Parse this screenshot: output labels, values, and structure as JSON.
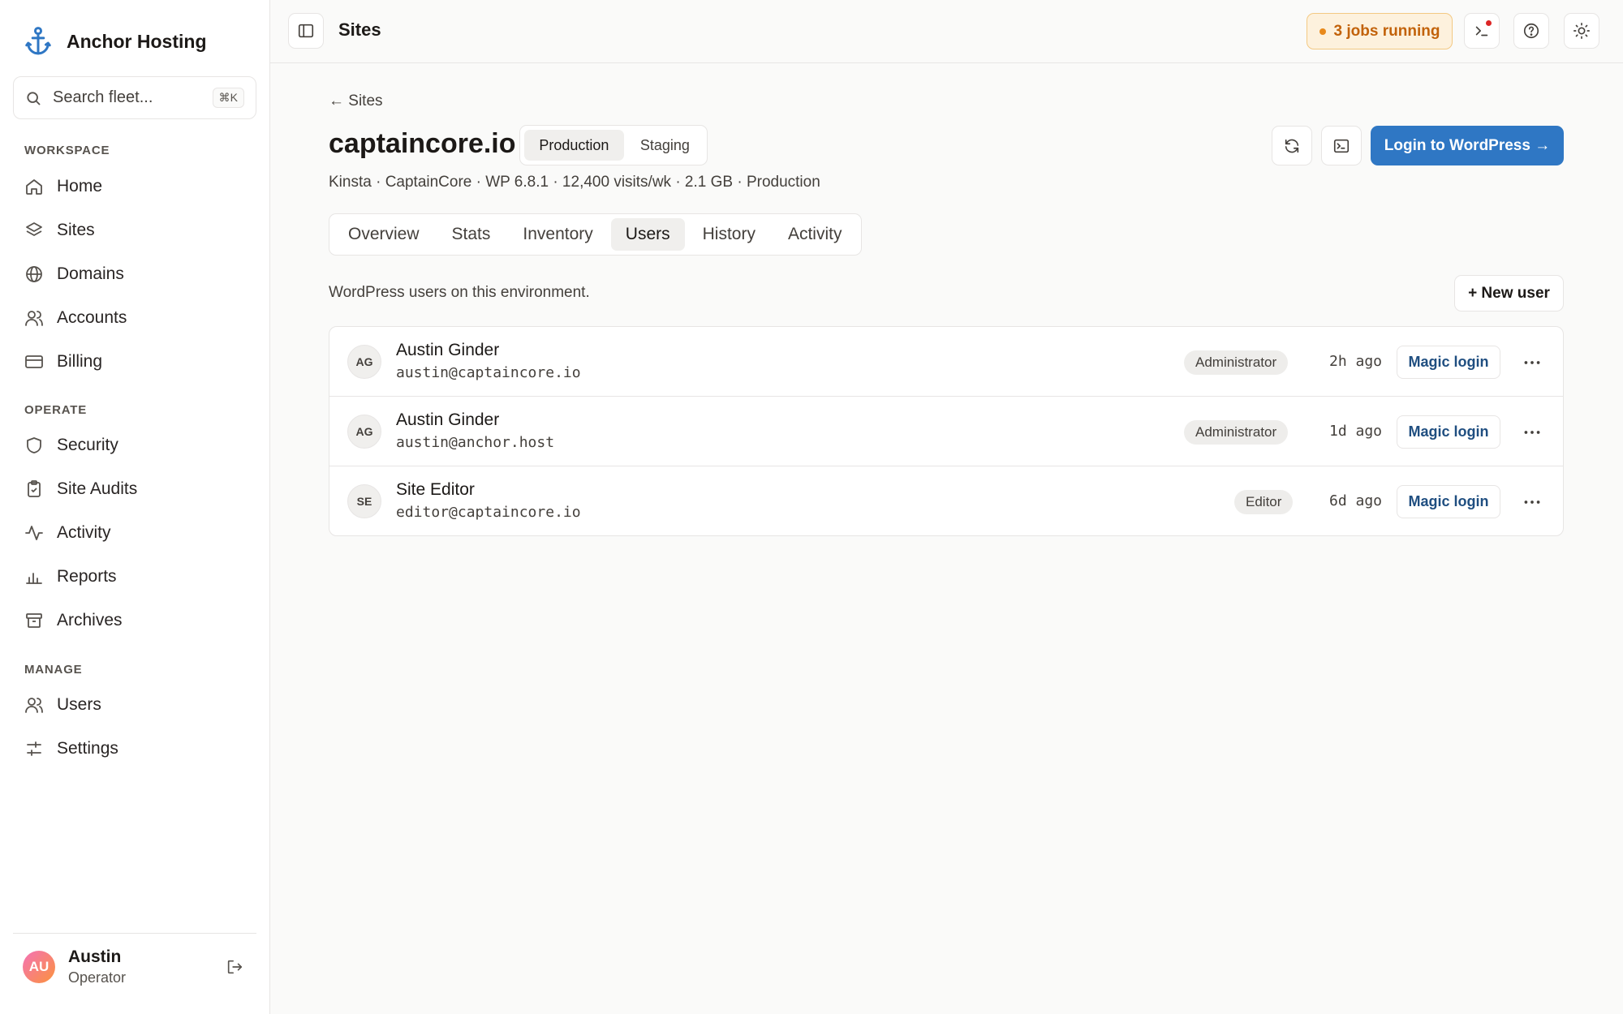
{
  "sidebar": {
    "brand": "Anchor Hosting",
    "search_placeholder": "Search fleet...",
    "search_shortcut": "⌘K",
    "sections": [
      "WORKSPACE",
      "OPERATE",
      "MANAGE"
    ],
    "items": [
      {
        "label": "Home",
        "icon": "home-icon"
      },
      {
        "label": "Sites",
        "icon": "layers-icon"
      },
      {
        "label": "Domains",
        "icon": "globe-icon"
      },
      {
        "label": "Accounts",
        "icon": "users-icon"
      },
      {
        "label": "Billing",
        "icon": "credit-card-icon"
      },
      {
        "label": "Security",
        "icon": "shield-icon"
      },
      {
        "label": "Site Audits",
        "icon": "clipboard-check-icon"
      },
      {
        "label": "Activity",
        "icon": "activity-icon"
      },
      {
        "label": "Reports",
        "icon": "bar-chart-icon"
      },
      {
        "label": "Archives",
        "icon": "archive-icon"
      },
      {
        "label": "Users",
        "icon": "users-icon"
      },
      {
        "label": "Settings",
        "icon": "sliders-icon"
      }
    ],
    "user": {
      "initials": "AU",
      "name": "Austin",
      "role": "Operator"
    }
  },
  "topbar": {
    "title": "Sites",
    "jobs": "3 jobs running"
  },
  "site": {
    "back": "← Sites",
    "title": "captaincore.io",
    "env_options": [
      "Production",
      "Staging"
    ],
    "env_selected": "Production",
    "meta": "Kinsta · CaptainCore · WP 6.8.1 · 12,400 visits/wk · 2.1 GB · Production",
    "login_button": "Login to WordPress →"
  },
  "tabs": [
    "Overview",
    "Stats",
    "Inventory",
    "Users",
    "History",
    "Activity"
  ],
  "active_tab": "Users",
  "users": {
    "description": "WordPress users on this environment.",
    "new_button": "+ New user",
    "magic_label": "Magic login",
    "rows": [
      {
        "initials": "AG",
        "name": "Austin Ginder",
        "email": "austin@captaincore.io",
        "role": "Administrator",
        "ago": "2h ago"
      },
      {
        "initials": "AG",
        "name": "Austin Ginder",
        "email": "austin@anchor.host",
        "role": "Administrator",
        "ago": "1d ago"
      },
      {
        "initials": "SE",
        "name": "Site Editor",
        "email": "editor@captaincore.io",
        "role": "Editor",
        "ago": "6d ago"
      }
    ]
  },
  "colors": {
    "accent": "#2f77c4",
    "jobs_text": "#c2620a",
    "jobs_bg": "#fdf1dd"
  }
}
